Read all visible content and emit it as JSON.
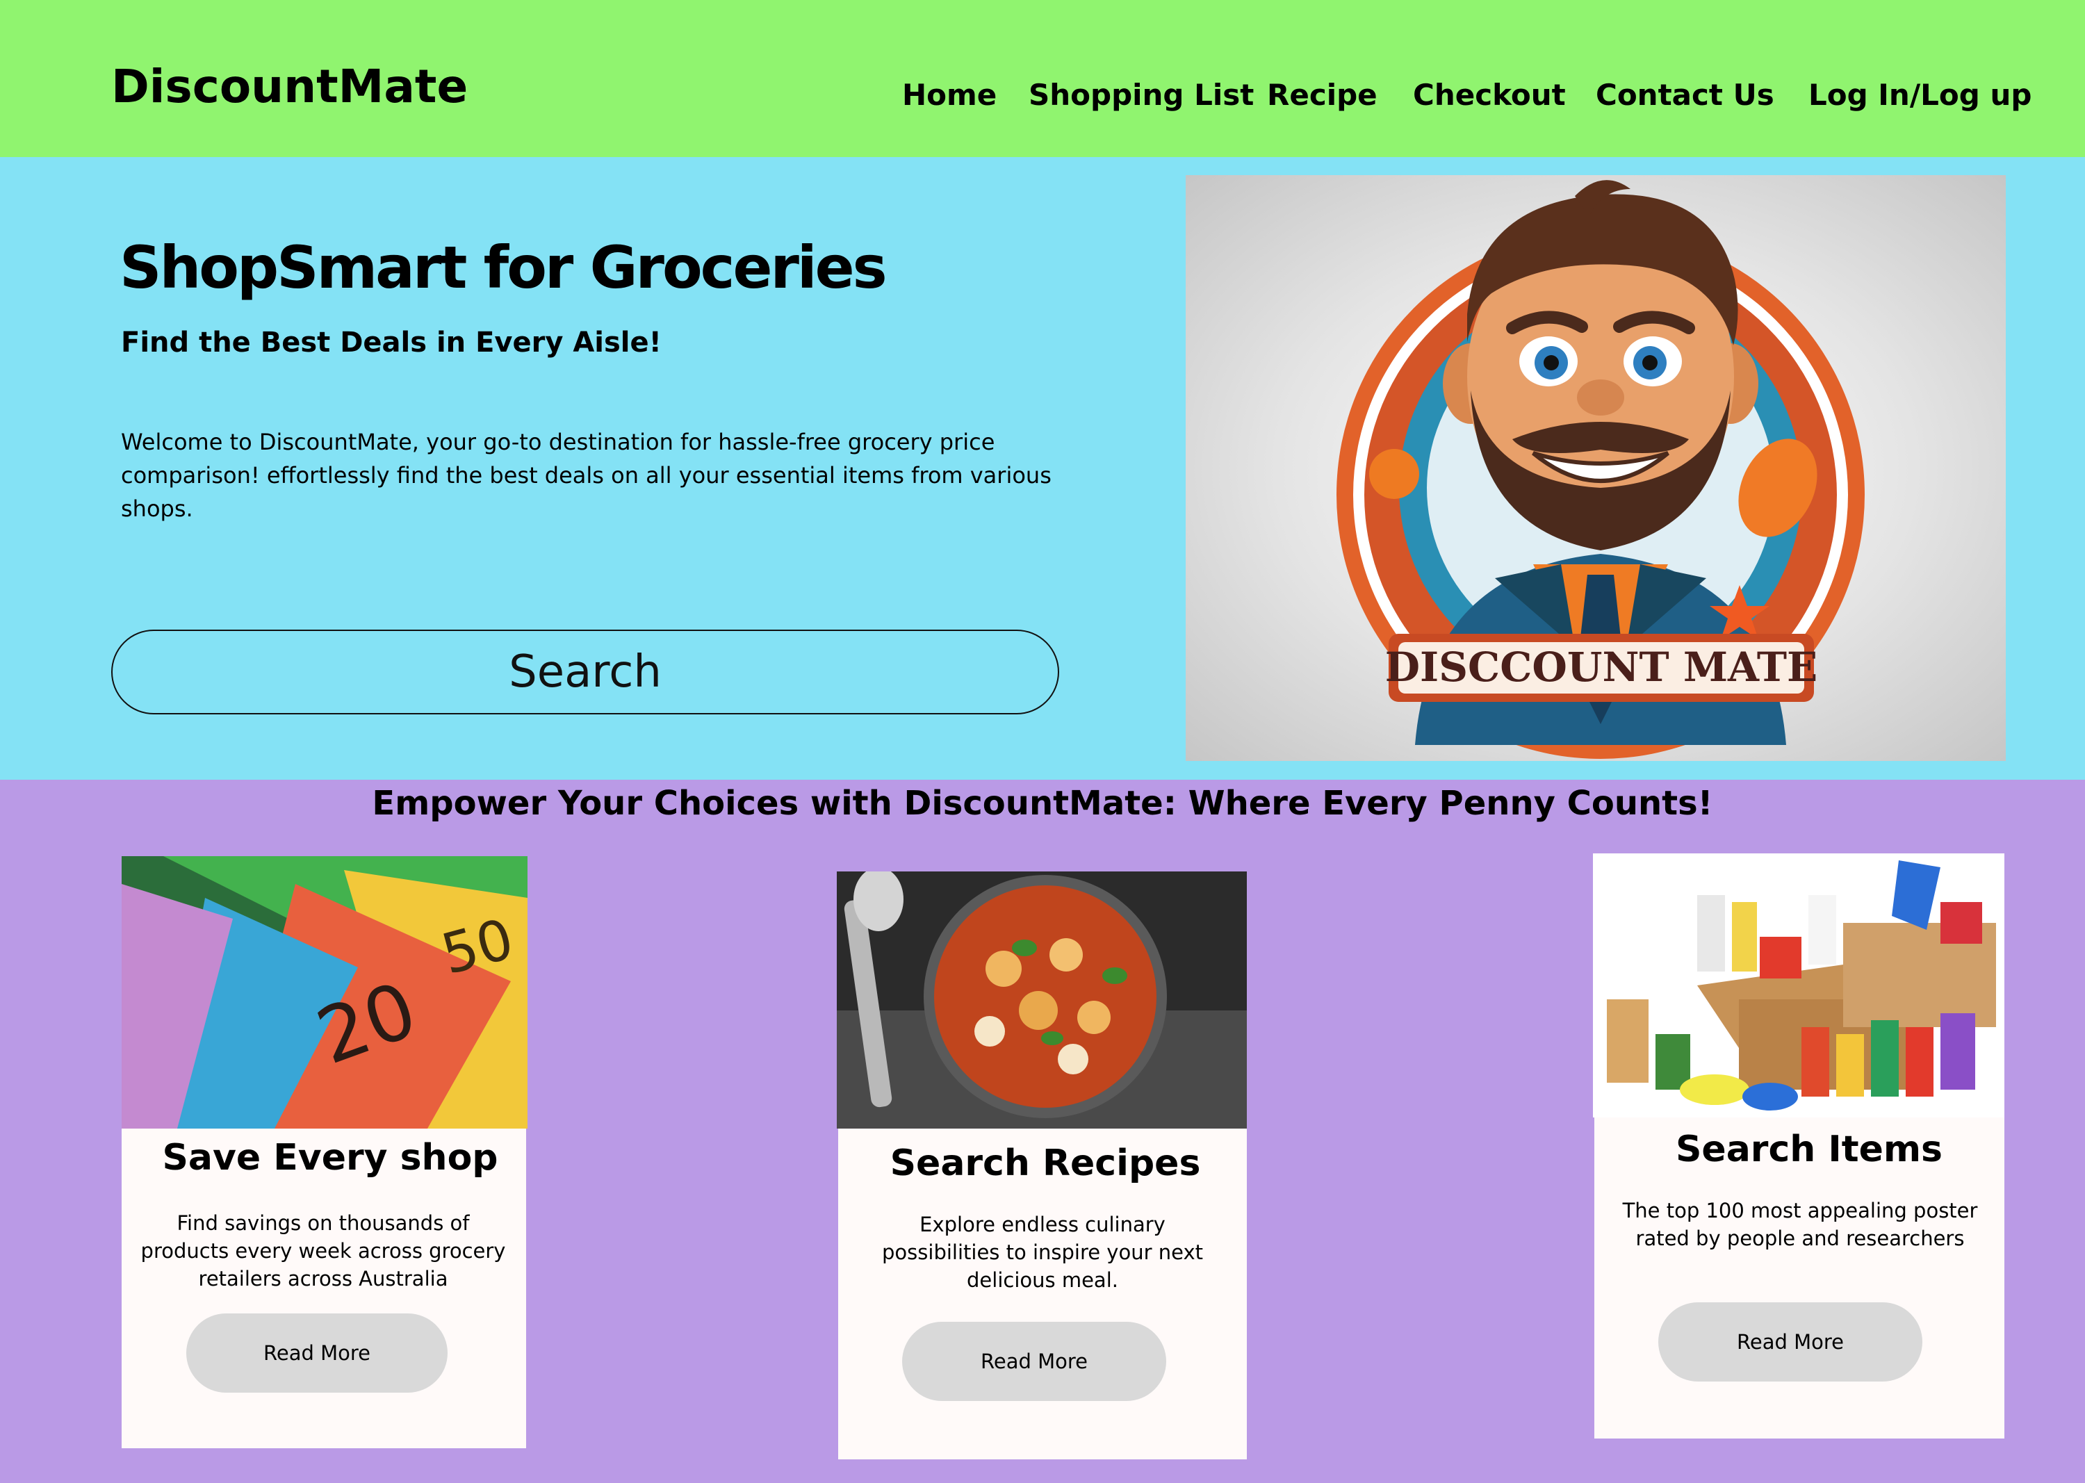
{
  "header": {
    "logo": "DiscountMate",
    "nav": [
      "Home",
      "Shopping List",
      "Recipe",
      "Checkout",
      "Contact Us",
      "Log In/Log up"
    ]
  },
  "hero": {
    "title": "ShopSmart for Groceries",
    "subtitle": "Find the Best Deals in Every Aisle!",
    "description": "Welcome to DiscountMate, your go-to destination for hassle-free grocery price comparison! effortlessly find the best deals on all your essential items from various shops.",
    "search_label": "Search",
    "mascot_banner": "DISCCOUNT MATE"
  },
  "features": {
    "heading": "Empower Your Choices with DiscountMate: Where Every Penny Counts!",
    "cards": [
      {
        "title": "Save Every shop",
        "text": "Find savings on thousands of products every week across grocery retailers across Australia",
        "button": "Read More",
        "image": "australian-banknotes-image"
      },
      {
        "title": "Search Recipes",
        "text": "Explore endless culinary possibilities to inspire your next delicious meal.",
        "button": "Read More",
        "image": "gnocchi-dish-image"
      },
      {
        "title": "Search Items",
        "text": "The top 100 most appealing poster rated by people and researchers",
        "button": "Read More",
        "image": "grocery-box-image"
      }
    ]
  },
  "colors": {
    "header_bg": "#90f46f",
    "hero_bg": "#84e2f5",
    "features_bg": "#ba9ae6",
    "card_bg": "#fffaf9",
    "button_bg": "#d9d9d9"
  }
}
